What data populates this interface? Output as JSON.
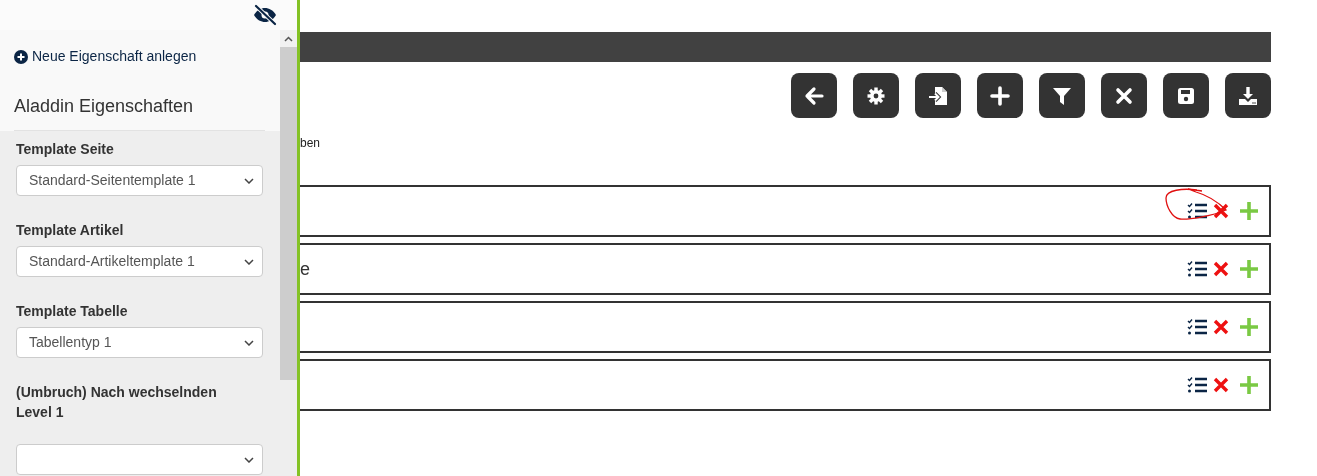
{
  "sidebar": {
    "new_property_link": "Neue Eigenschaft anlegen",
    "title": "Aladdin Eigenschaften",
    "fields": [
      {
        "label": "Template Seite",
        "value": "Standard-Seitentemplate 1"
      },
      {
        "label": "Template Artikel",
        "value": "Standard-Artikeltemplate 1"
      },
      {
        "label": "Template Tabelle",
        "value": "Tabellentyp 1"
      },
      {
        "label": "(Umbruch) Nach wechselnden Level 1"
      }
    ]
  },
  "main": {
    "partial_text": "ben",
    "rows": [
      {
        "circled": true
      },
      {
        "label": "e",
        "circled": false
      },
      {
        "circled": false
      },
      {
        "circled": false
      }
    ]
  }
}
